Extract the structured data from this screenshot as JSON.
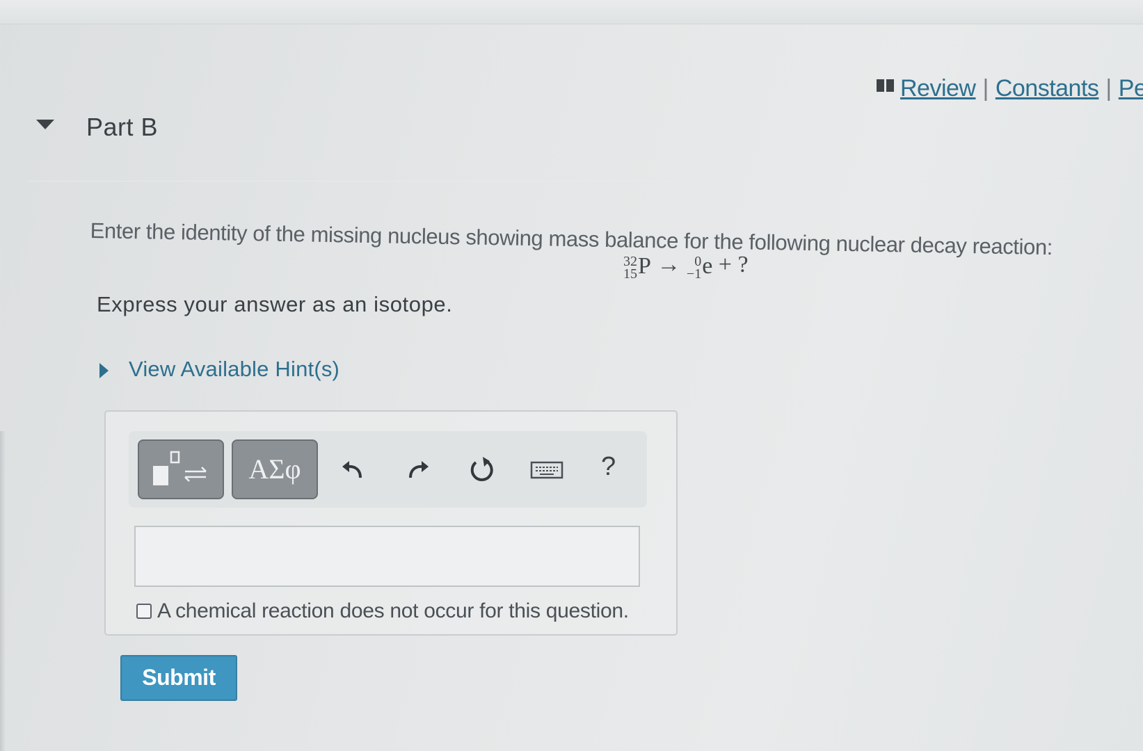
{
  "header": {
    "links": [
      {
        "label": "Review"
      },
      {
        "label": "Constants"
      },
      {
        "label": "Pe"
      }
    ],
    "separator": "|"
  },
  "part": {
    "title": "Part B"
  },
  "question": {
    "prompt": "Enter the identity of the missing nucleus showing mass balance for the following nuclear decay reaction:",
    "equation": {
      "reactant": {
        "mass": "32",
        "atomic": "15",
        "symbol": "P"
      },
      "arrow": "→",
      "product1": {
        "mass": "0",
        "atomic": "−1",
        "symbol": "e"
      },
      "plus": "+",
      "unknown": "?"
    },
    "instructions": "Express your answer as an isotope.",
    "hint_link": "View Available Hint(s)"
  },
  "toolbar": {
    "greek_label": "ΑΣφ",
    "help_label": "?"
  },
  "answer": {
    "value": "",
    "no_reaction_label": "A chemical reaction does not occur for this question."
  },
  "submit_label": "Submit"
}
